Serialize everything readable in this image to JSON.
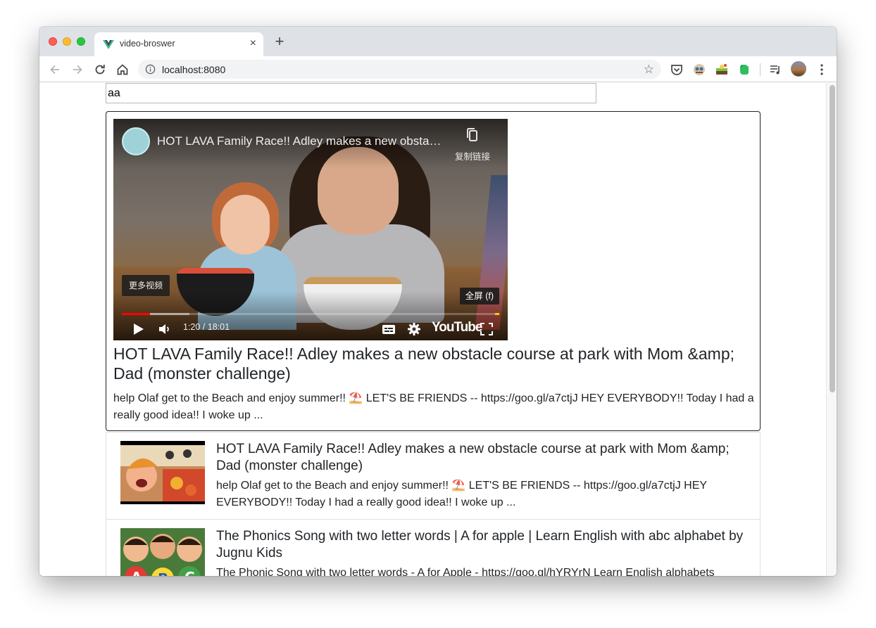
{
  "browser": {
    "tab_title": "video-broswer",
    "tab_close": "×",
    "new_tab": "+",
    "url": "localhost:8080"
  },
  "colors": {
    "tabstrip": "#dee1e6",
    "youtube_red": "#ff0000",
    "text": "#212529"
  },
  "search": {
    "value": "aa",
    "icon_names": [
      "back-icon",
      "forward-icon",
      "reload-icon",
      "home-icon",
      "info-icon",
      "star-icon"
    ]
  },
  "player": {
    "title": "HOT LAVA Family Race!! Adley makes a new obstacle course at park with Mom &amp; Dad (monster challenge)",
    "copy_link_label": "复制链接",
    "more_videos_label": "更多视频",
    "fullscreen_tip": "全屏 (f)",
    "time": "1:20 / 18:01",
    "logo": "YouTube",
    "progress_played_fraction": 0.074,
    "progress_buffered_fraction": 0.18
  },
  "detail": {
    "title": "HOT LAVA Family Race!! Adley makes a new obstacle course at park with Mom &amp; Dad (monster challenge)",
    "description": "help Olaf get to the Beach and enjoy summer!! ⛱️ LET'S BE FRIENDS -- https://goo.gl/a7ctjJ HEY EVERYBODY!! Today I had a really good idea!! I woke up ..."
  },
  "videos": [
    {
      "title": "HOT LAVA Family Race!! Adley makes a new obstacle course at park with Mom &amp; Dad (monster challenge)",
      "description": "help Olaf get to the Beach and enjoy summer!! ⛱️ LET'S BE FRIENDS -- https://goo.gl/a7ctjJ HEY EVERYBODY!! Today I had a really good idea!! I woke up ..."
    },
    {
      "title": "The Phonics Song with two letter words | A for apple | Learn English with abc alphabet by Jugnu Kids",
      "description": "The Phonic Song with two letter words - A for Apple - https://goo.gl/hYRYrN Learn English alphabets"
    }
  ]
}
